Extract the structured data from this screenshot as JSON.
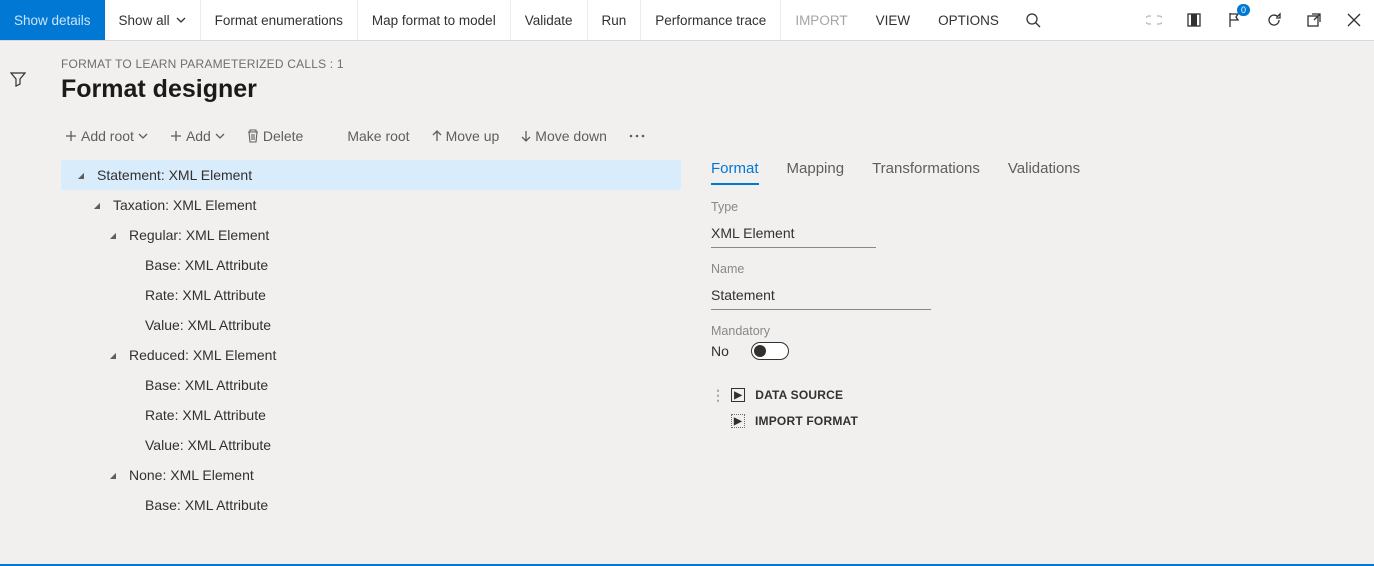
{
  "menubar": {
    "show_details": "Show details",
    "show_all": "Show all",
    "format_enum": "Format enumerations",
    "map_format": "Map format to model",
    "validate": "Validate",
    "run": "Run",
    "perf_trace": "Performance trace",
    "import": "IMPORT",
    "view": "VIEW",
    "options": "OPTIONS"
  },
  "breadcrumb": "FORMAT TO LEARN PARAMETERIZED CALLS : 1",
  "page_title": "Format designer",
  "toolbar": {
    "add_root": "Add root",
    "add": "Add",
    "delete": "Delete",
    "make_root": "Make root",
    "move_up": "Move up",
    "move_down": "Move down"
  },
  "tree": [
    {
      "depth": 0,
      "exp": true,
      "label": "Statement: XML Element",
      "selected": true
    },
    {
      "depth": 1,
      "exp": true,
      "label": "Taxation: XML Element"
    },
    {
      "depth": 2,
      "exp": true,
      "label": "Regular: XML Element"
    },
    {
      "depth": 3,
      "exp": false,
      "label": "Base: XML Attribute"
    },
    {
      "depth": 3,
      "exp": false,
      "label": "Rate: XML Attribute"
    },
    {
      "depth": 3,
      "exp": false,
      "label": "Value: XML Attribute"
    },
    {
      "depth": 2,
      "exp": true,
      "label": "Reduced: XML Element"
    },
    {
      "depth": 3,
      "exp": false,
      "label": "Base: XML Attribute"
    },
    {
      "depth": 3,
      "exp": false,
      "label": "Rate: XML Attribute"
    },
    {
      "depth": 3,
      "exp": false,
      "label": "Value: XML Attribute"
    },
    {
      "depth": 2,
      "exp": true,
      "label": "None: XML Element"
    },
    {
      "depth": 3,
      "exp": false,
      "label": "Base: XML Attribute"
    }
  ],
  "tabs": {
    "format": "Format",
    "mapping": "Mapping",
    "transformations": "Transformations",
    "validations": "Validations"
  },
  "detail": {
    "type_label": "Type",
    "type_value": "XML Element",
    "name_label": "Name",
    "name_value": "Statement",
    "mandatory_label": "Mandatory",
    "mandatory_value": "No",
    "data_source": "DATA SOURCE",
    "import_format": "IMPORT FORMAT"
  },
  "notification_count": "0"
}
